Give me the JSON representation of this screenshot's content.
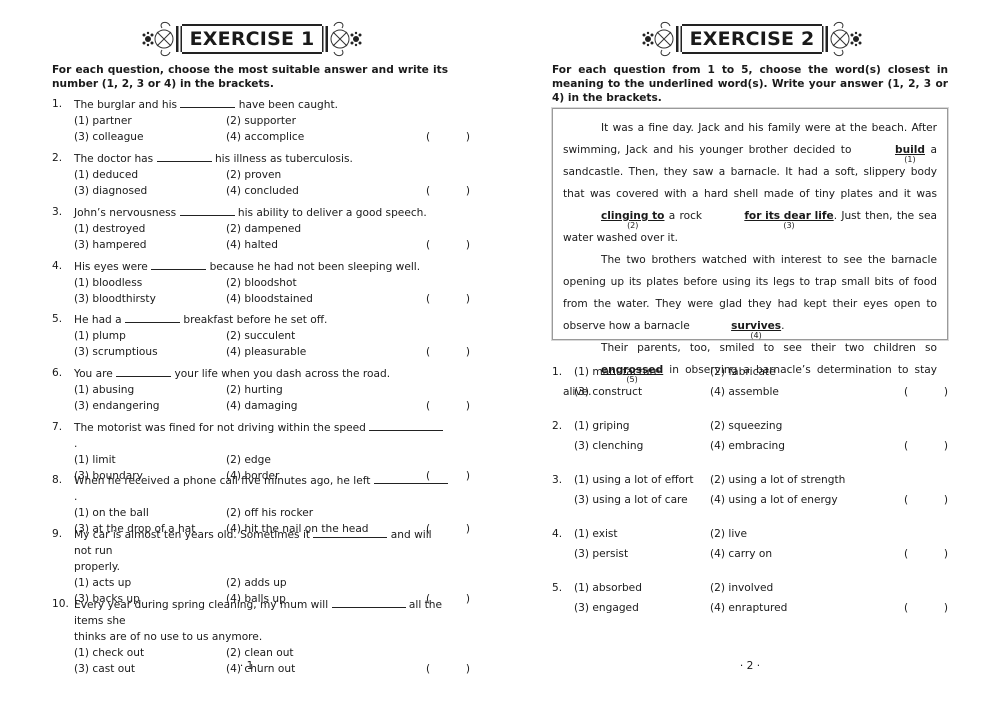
{
  "exercise1": {
    "title": "EXERCISE 1",
    "instructions": "For each question, choose the most suitable answer and write its number (1, 2, 3 or 4) in the brackets.",
    "questions": [
      {
        "num": "1.",
        "before": "The burglar and his",
        "after": "have been caught.",
        "options": [
          "(1) partner",
          "(2) supporter",
          "(3) colleague",
          "(4) accomplice"
        ]
      },
      {
        "num": "2.",
        "before": "The doctor has",
        "after": "his illness as tuberculosis.",
        "options": [
          "(1) deduced",
          "(2) proven",
          "(3) diagnosed",
          "(4) concluded"
        ]
      },
      {
        "num": "3.",
        "before": "John’s nervousness",
        "after": "his ability to deliver a good speech.",
        "options": [
          "(1) destroyed",
          "(2) dampened",
          "(3) hampered",
          "(4) halted"
        ]
      },
      {
        "num": "4.",
        "before": "His eyes were",
        "after": "because he had not been sleeping well.",
        "options": [
          "(1) bloodless",
          "(2) bloodshot",
          "(3) bloodthirsty",
          "(4) bloodstained"
        ]
      },
      {
        "num": "5.",
        "before": "He had a",
        "after": "breakfast before he set off.",
        "options": [
          "(1) plump",
          "(2) succulent",
          "(3) scrumptious",
          "(4) pleasurable"
        ]
      },
      {
        "num": "6.",
        "before": "You are",
        "after": "your life when you dash across the road.",
        "options": [
          "(1) abusing",
          "(2) hurting",
          "(3) endangering",
          "(4) damaging"
        ]
      },
      {
        "num": "7.",
        "before": "The motorist was fined for not driving within the speed",
        "after": ".",
        "options": [
          "(1) limit",
          "(2) edge",
          "(3) boundary",
          "(4) border"
        ]
      },
      {
        "num": "8.",
        "before": "When he received a phone call five minutes ago, he left",
        "after": ".",
        "options": [
          "(1) on the ball",
          "(2) off his rocker",
          "(3) at the drop of a hat",
          "(4) hit the nail on the head"
        ]
      },
      {
        "num": "9.",
        "before": "My car is almost ten years old. Sometimes it",
        "after": "and will not run",
        "line2": "properly.",
        "options": [
          "(1) acts up",
          "(2) adds up",
          "(3) backs up",
          "(4) balls up"
        ]
      },
      {
        "num": "10.",
        "before": "Every year during spring cleaning, my mum will",
        "after": "all the items she",
        "line2": "thinks are of no use to us anymore.",
        "options": [
          "(1) check out",
          "(2) clean out",
          "(3) cast out",
          "(4) churn out"
        ]
      }
    ],
    "bracket_open": "(",
    "bracket_close": ")",
    "page_number": "· 1 ·"
  },
  "exercise2": {
    "title": "EXERCISE 2",
    "instructions": "For each question from 1 to 5, choose the word(s) closest in meaning to the underlined word(s). Write your answer (1, 2, 3 or 4) in the brackets.",
    "passage": {
      "p1_a": "It was a fine day. Jack and his family were at the beach. After swimming, Jack and his younger brother decided to ",
      "u1": "build",
      "m1": "(1)",
      "p1_b": " a sandcastle. Then, they saw a barnacle. It had a soft, slippery body that was covered with a hard shell made of tiny plates and it was ",
      "u2": "clinging to",
      "m2": "(2)",
      "p1_c": " a rock ",
      "u3": "for its dear life",
      "m3": "(3)",
      "p1_d": ". Just then, the sea water washed over it.",
      "p2_a": "The two brothers watched with interest to see the barnacle opening up its plates before using its legs to trap small bits of food from the water. They were glad they had kept their eyes open to observe how a barnacle ",
      "u4": "survives",
      "m4": "(4)",
      "p2_b": ".",
      "p3_a": "Their parents, too, smiled to see their two children so ",
      "u5": "engrossed",
      "m5": "(5)",
      "p3_b": " in observing a barnacle’s determination to stay alive."
    },
    "questions": [
      {
        "num": "1.",
        "options": [
          "(1) manufacture",
          "(2) fabricate",
          "(3) construct",
          "(4) assemble"
        ]
      },
      {
        "num": "2.",
        "options": [
          "(1) griping",
          "(2) squeezing",
          "(3) clenching",
          "(4) embracing"
        ]
      },
      {
        "num": "3.",
        "options": [
          "(1) using a lot of effort",
          "(2) using a lot of strength",
          "(3) using a lot of care",
          "(4) using a lot of energy"
        ]
      },
      {
        "num": "4.",
        "options": [
          "(1) exist",
          "(2) live",
          "(3) persist",
          "(4) carry on"
        ]
      },
      {
        "num": "5.",
        "options": [
          "(1) absorbed",
          "(2) involved",
          "(3) engaged",
          "(4) enraptured"
        ]
      }
    ],
    "bracket_open": "(",
    "bracket_close": ")",
    "page_number": "· 2 ·"
  }
}
